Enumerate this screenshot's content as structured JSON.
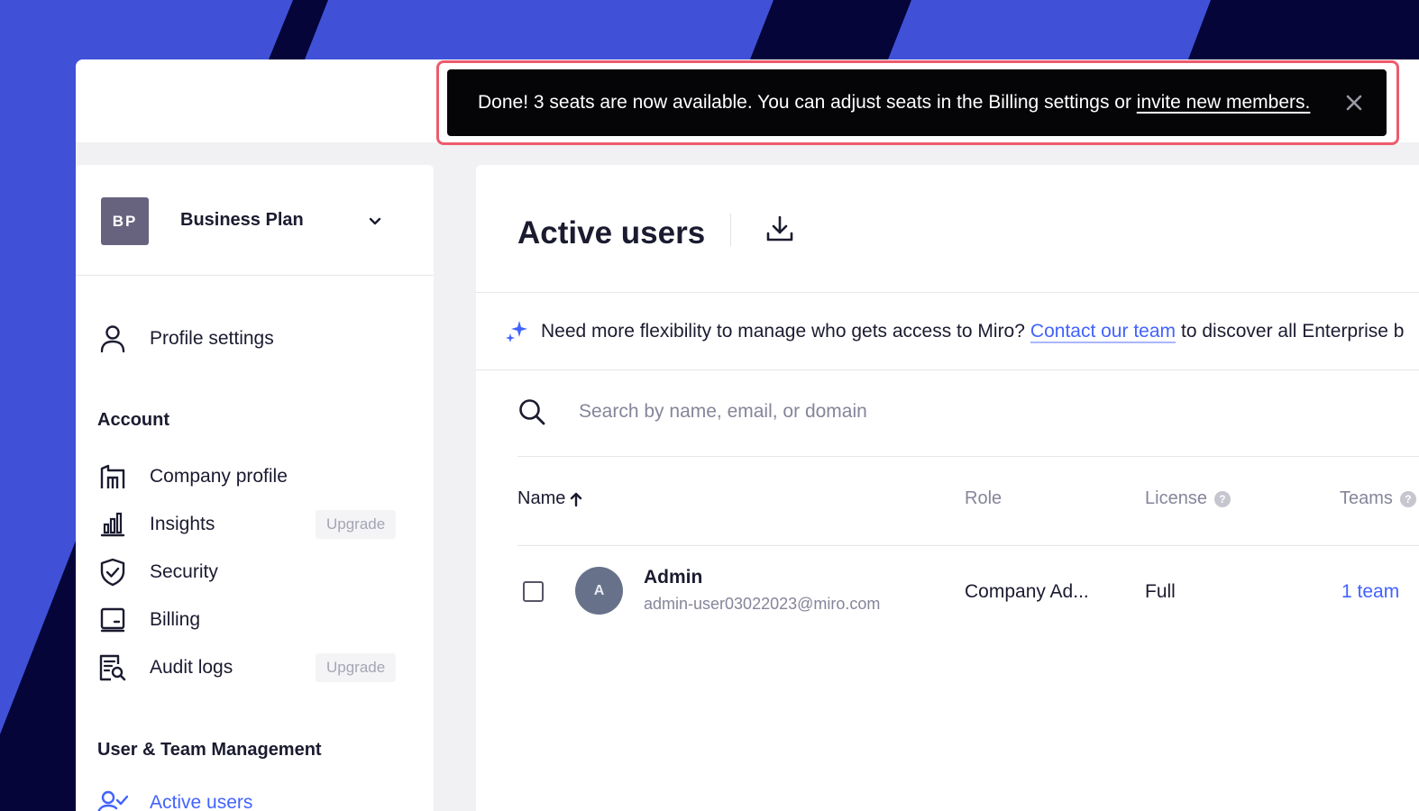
{
  "toast": {
    "message": "Done! 3 seats are now available. You can adjust seats in the Billing settings or",
    "link": "invite new members."
  },
  "sidebar": {
    "plan": {
      "initials": "BP",
      "name": "Business Plan"
    },
    "profile": {
      "label": "Profile settings"
    },
    "account_title": "Account",
    "account_items": [
      {
        "label": "Company profile",
        "icon": "building-icon"
      },
      {
        "label": "Insights",
        "icon": "bar-chart-icon",
        "badge": "Upgrade"
      },
      {
        "label": "Security",
        "icon": "shield-check-icon"
      },
      {
        "label": "Billing",
        "icon": "billing-icon"
      },
      {
        "label": "Audit logs",
        "icon": "audit-log-icon",
        "badge": "Upgrade"
      }
    ],
    "management_title": "User & Team Management",
    "management_items": [
      {
        "label": "Active users",
        "icon": "active-users-icon"
      }
    ]
  },
  "main": {
    "title": "Active users",
    "promo": {
      "before": "Need more flexibility to manage who gets access to Miro?",
      "link": "Contact our team",
      "after": "to discover all Enterprise b"
    },
    "search": {
      "placeholder": "Search by name, email, or domain"
    },
    "table": {
      "headers": {
        "name": "Name",
        "role": "Role",
        "license": "License",
        "teams": "Teams"
      },
      "rows": [
        {
          "initial": "A",
          "name": "Admin",
          "email": "admin-user03022023@miro.com",
          "role": "Company Ad...",
          "license": "Full",
          "teams": "1 team"
        }
      ]
    }
  },
  "colors": {
    "background": "#4051d8",
    "stripe": "#05053a",
    "accent": "#4262ff",
    "toast": "#050508",
    "highlight": "#ee5b6e"
  }
}
